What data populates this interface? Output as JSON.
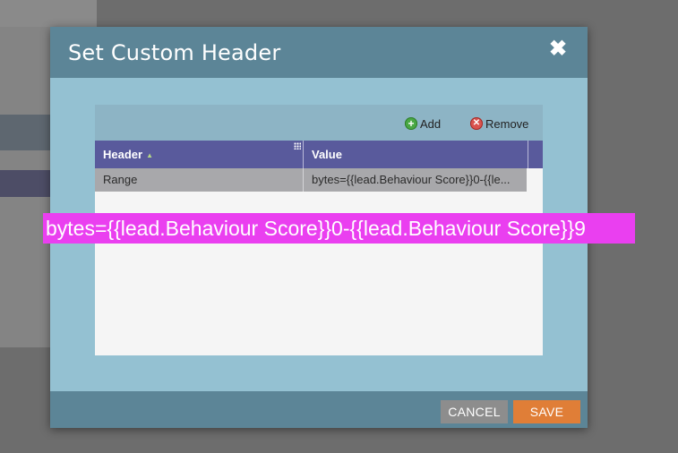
{
  "dialog": {
    "title": "Set Custom Header",
    "close_symbol": "✖"
  },
  "toolbar": {
    "add_label": "Add",
    "remove_label": "Remove",
    "add_icon": "plus-circle-icon",
    "remove_icon": "x-circle-icon"
  },
  "grid": {
    "columns": [
      "Header",
      "Value"
    ],
    "rows": [
      {
        "header": "Range",
        "value": "bytes={{lead.Behaviour Score}}0-{{le..."
      }
    ]
  },
  "tooltip": {
    "text": "bytes={{lead.Behaviour Score}}0-{{lead.Behaviour Score}}9"
  },
  "footer": {
    "cancel_label": "CANCEL",
    "save_label": "SAVE"
  },
  "colors": {
    "header_bar": "#5c8597",
    "dialog_body": "#94c1d2",
    "grid_header": "#595a9c",
    "save_button": "#e07e37",
    "cancel_button": "#8d8d8d",
    "highlight": "#ea3ff0"
  }
}
